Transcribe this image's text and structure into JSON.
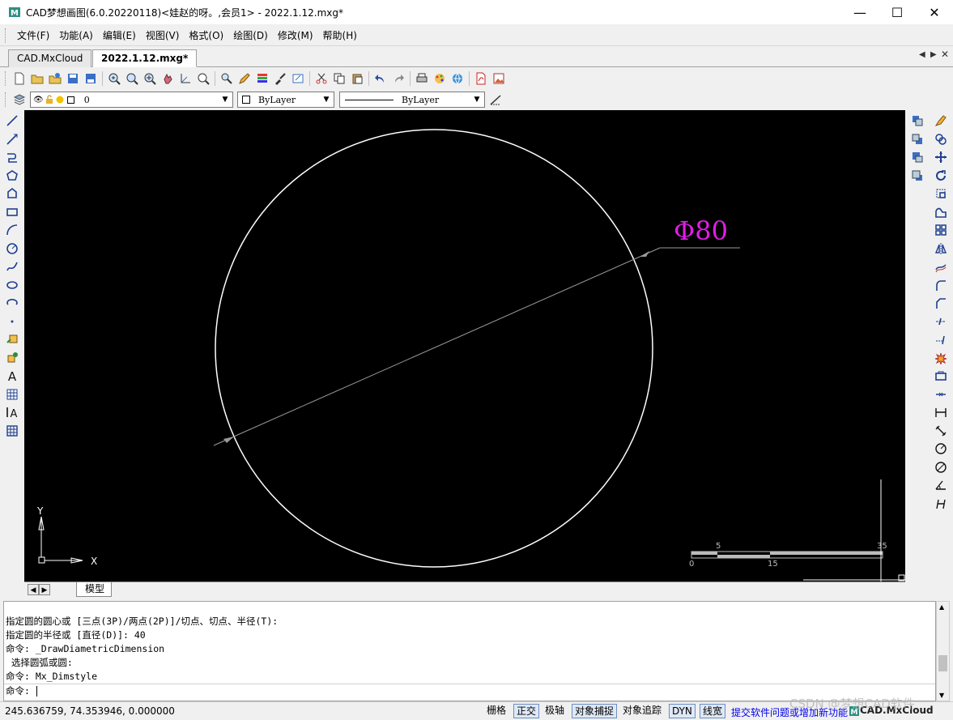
{
  "window": {
    "title": "CAD梦想画图(6.0.20220118)<娃赵的呀。,会员1> - 2022.1.12.mxg*",
    "minimize": "—",
    "maximize": "☐",
    "close": "✕"
  },
  "menu": {
    "items": [
      "文件(F)",
      "功能(A)",
      "编辑(E)",
      "视图(V)",
      "格式(O)",
      "绘图(D)",
      "修改(M)",
      "帮助(H)"
    ]
  },
  "tabs": [
    {
      "label": "CAD.MxCloud"
    },
    {
      "label": "2022.1.12.mxg*"
    }
  ],
  "layer_toolbar": {
    "layer_value": "0",
    "color_value": "ByLayer",
    "linetype_value": "ByLayer"
  },
  "drawing": {
    "dimension_text": "Φ80",
    "axis_y": "Y",
    "axis_x": "X",
    "scale": {
      "top_left": "5",
      "top_right": "35",
      "bottom_left": "0",
      "bottom_mid": "15"
    },
    "colors": {
      "background": "#000000",
      "circle": "#ffffff",
      "dimension_line": "#9a9a9a",
      "dimension_text": "#e11ee6"
    }
  },
  "layout_tabs": {
    "model": "模型"
  },
  "command": {
    "lines": [
      "指定圆的圆心或 [三点(3P)/两点(2P)]/切点、切点、半径(T):",
      "指定圆的半径或 [直径(D)]: 40",
      "命令: _DrawDiametricDimension",
      " 选择圆弧或圆:",
      "命令: Mx_Dimstyle"
    ],
    "prompt": "命令:"
  },
  "status": {
    "coords": "245.636759,  74.353946,  0.000000",
    "buttons": [
      {
        "label": "栅格",
        "on": false
      },
      {
        "label": "正交",
        "on": true
      },
      {
        "label": "极轴",
        "on": false
      },
      {
        "label": "对象捕捉",
        "on": true
      },
      {
        "label": "对象追踪",
        "on": false
      },
      {
        "label": "DYN",
        "on": true
      },
      {
        "label": "线宽",
        "on": true
      }
    ],
    "feedback_link": "提交软件问题或增加新功能",
    "brand": "CAD.MxCloud"
  },
  "watermark": "CSDN @梦想CAD软件"
}
